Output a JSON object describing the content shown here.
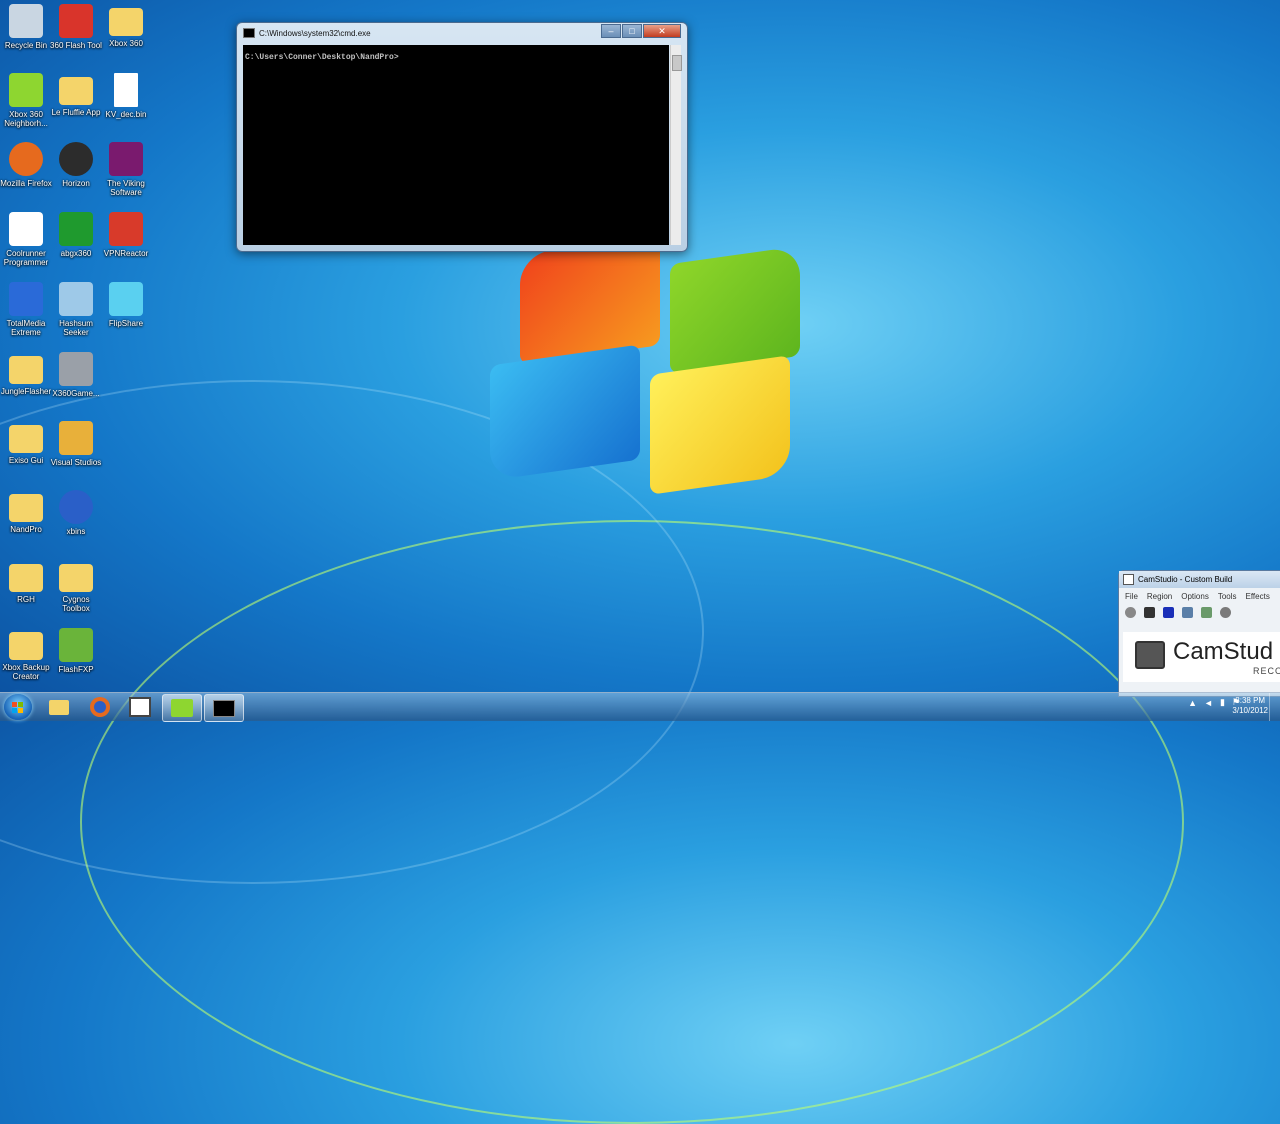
{
  "desktop": {
    "icons": [
      {
        "label": "Recycle Bin",
        "icon": "recycle-bin-icon",
        "color": "#c9d6e2"
      },
      {
        "label": "360 Flash Tool",
        "icon": "flash-tool-icon",
        "color": "#d9342b"
      },
      {
        "label": "Xbox 360",
        "icon": "folder-icon",
        "color": "#f4d46a"
      },
      {
        "label": "Xbox 360 Neighborh...",
        "icon": "xbox-neighborhood-icon",
        "color": "#8ed630"
      },
      {
        "label": "Le Fluffie App",
        "icon": "folder-icon",
        "color": "#f4d46a"
      },
      {
        "label": "KV_dec.bin",
        "icon": "file-icon",
        "color": "#ffffff"
      },
      {
        "label": "Mozilla Firefox",
        "icon": "firefox-icon",
        "color": "#e66a1e"
      },
      {
        "label": "Horizon",
        "icon": "xbox-icon",
        "color": "#2c2c2c"
      },
      {
        "label": "The Viking Software",
        "icon": "viking-icon",
        "color": "#7a1a6e"
      },
      {
        "label": "Coolrunner Programmer",
        "icon": "runner-icon",
        "color": "#ffffff"
      },
      {
        "label": "abgx360",
        "icon": "abgx-icon",
        "color": "#1f9a2e"
      },
      {
        "label": "VPNReactor",
        "icon": "vpn-icon",
        "color": "#d83a2a"
      },
      {
        "label": "TotalMedia Extreme",
        "icon": "totalmedia-icon",
        "color": "#2a6ad8"
      },
      {
        "label": "Hashsum Seeker",
        "icon": "hashsum-icon",
        "color": "#9ec9e8"
      },
      {
        "label": "FlipShare",
        "icon": "flip-icon",
        "color": "#5ad0f0"
      },
      {
        "label": "JungleFlasher",
        "icon": "folder-icon",
        "color": "#f4d46a"
      },
      {
        "label": "X360Game...",
        "icon": "game-tool-icon",
        "color": "#9aa0a8"
      },
      {
        "label": "Exiso Gui",
        "icon": "folder-icon",
        "color": "#f4d46a"
      },
      {
        "label": "Visual Studios",
        "icon": "visual-studio-icon",
        "color": "#e8b03a"
      },
      {
        "label": "NandPro",
        "icon": "folder-icon",
        "color": "#f4d46a"
      },
      {
        "label": "xbins",
        "icon": "globe-icon",
        "color": "#2a5fc8"
      },
      {
        "label": "RGH",
        "icon": "folder-icon",
        "color": "#f4d46a"
      },
      {
        "label": "Cygnos Toolbox",
        "icon": "folder-icon",
        "color": "#f4d46a"
      },
      {
        "label": "Xbox Backup Creator",
        "icon": "folder-icon",
        "color": "#f4d46a"
      },
      {
        "label": "FlashFXP",
        "icon": "flashfxp-icon",
        "color": "#6ab43a"
      }
    ]
  },
  "cmd": {
    "title": "C:\\Windows\\system32\\cmd.exe",
    "prompt": "C:\\Users\\Conner\\Desktop\\NandPro>",
    "minimize": "–",
    "maximize": "□",
    "close": "✕"
  },
  "camstudio": {
    "title": "CamStudio - Custom Build",
    "menu": [
      "File",
      "Region",
      "Options",
      "Tools",
      "Effects"
    ],
    "banner_name": "CamStud",
    "banner_sub": "RECO"
  },
  "taskbar": {
    "clock_time": "8:38 PM",
    "clock_date": "3/10/2012",
    "apps": [
      "explorer-icon",
      "firefox-icon",
      "window-icon",
      "xbox-neighborhood-icon",
      "cmd-icon"
    ]
  },
  "colors": {
    "accent": "#1477c8",
    "cmd_bg": "#000000"
  }
}
